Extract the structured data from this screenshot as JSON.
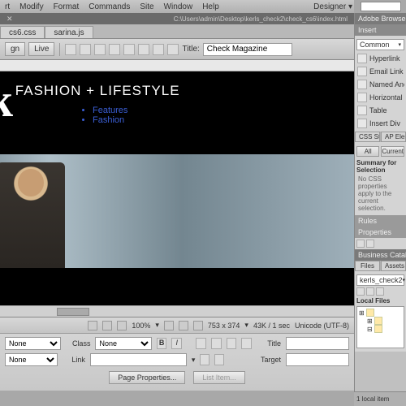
{
  "menu": {
    "items": [
      "rt",
      "Modify",
      "Format",
      "Commands",
      "Site",
      "Window",
      "Help"
    ],
    "workspace": "Designer"
  },
  "filepath": "C:\\Users\\admin\\Desktop\\kerls_check2\\check_cs6\\index.html",
  "file_tabs": [
    "cs6.css",
    "sarina.js"
  ],
  "view_buttons": {
    "design": "gn",
    "live": "Live"
  },
  "doc_title_label": "Title:",
  "doc_title": "Check Magazine",
  "page": {
    "logo": "heck",
    "tagline": "FASHION + LIFESTYLE",
    "nav": [
      "Features",
      "Fashion"
    ]
  },
  "status": {
    "zoom": "100%",
    "dims": "753 x 374",
    "size_time": "43K / 1 sec",
    "encoding": "Unicode (UTF-8)"
  },
  "properties": {
    "format": "None",
    "class": "None",
    "id": "None",
    "link": "",
    "title": "",
    "target": "",
    "class_label": "Class",
    "link_label": "Link",
    "title_label": "Title",
    "target_label": "Target",
    "page_props_btn": "Page Properties...",
    "list_item_btn": "List Item..."
  },
  "right": {
    "browserlab": "Adobe BrowserLab",
    "insert_tab": "Insert",
    "common": "Common",
    "insert_items": [
      "Hyperlink",
      "Email Link",
      "Named Anchor",
      "Horizontal Rule",
      "Table",
      "Insert Div"
    ],
    "css_tabs": [
      "CSS Styles",
      "AP Elements"
    ],
    "css_all": "All",
    "css_current": "Current",
    "summary_label": "Summary for Selection",
    "summary_text": "No CSS properties apply to the current selection.",
    "rules": "Rules",
    "properties": "Properties",
    "bc": "Business Catalyst",
    "files_tabs": [
      "Files",
      "Assets"
    ],
    "site": "kerls_check2",
    "local_files": "Local Files",
    "taskbar": "1 local item"
  }
}
